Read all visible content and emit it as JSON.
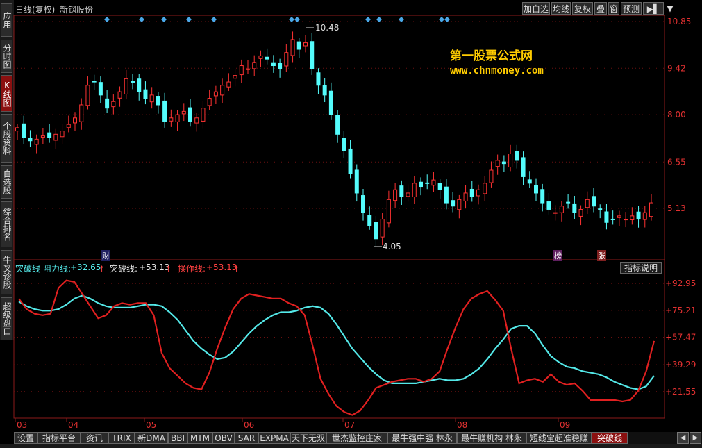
{
  "header": {
    "chart_mode": "日线(复权)",
    "stock_name": "新钢股份",
    "buttons": [
      "加自选",
      "均线",
      "复权",
      "叠",
      "窗",
      "预测"
    ],
    "menu_arrow": "▼"
  },
  "sidebar": {
    "items": [
      {
        "label": "应用",
        "active": false
      },
      {
        "label": "分时图",
        "active": false
      },
      {
        "label": "K线图",
        "active": true
      },
      {
        "label": "个股资料",
        "active": false
      },
      {
        "label": "自选股",
        "active": false
      },
      {
        "label": "综合排名",
        "active": false
      },
      {
        "label": "牛叉诊股",
        "active": false
      },
      {
        "label": "超级盘口",
        "active": false
      }
    ]
  },
  "watermark": {
    "line1": "第一股票公式网",
    "line2": "www.chnmoney.com"
  },
  "markers": {
    "cai": "财",
    "bang": "榜",
    "zhang": "张",
    "high_label": "10.48",
    "low_label": "4.05"
  },
  "indicator": {
    "name": "突破线",
    "resistance_label": "阻力线:",
    "resistance_value": "+32.65",
    "breakout_label": "突破线:",
    "breakout_value": "+53.13",
    "operation_label": "操作线:",
    "operation_value": "+53.13",
    "explain_button": "指标说明"
  },
  "tabs": [
    "设置",
    "指标平台",
    "资讯",
    "TRIX",
    "新DMA",
    "BBI",
    "MTM",
    "OBV",
    "SAR",
    "EXPMA",
    "天下无双",
    "世杰监控庄家",
    "最牛强中强 林永",
    "最牛赚机构 林永",
    "短线宝超准稳赚",
    "突破线"
  ],
  "active_tab": "突破线",
  "colors": {
    "up": "#ff3232",
    "down": "#54fcfc",
    "resistance": "#54e8e8",
    "breakout": "#e02020",
    "diamond": "#4aa8e8",
    "watermark": "#ffcc00"
  },
  "chart_data": [
    {
      "type": "candlestick",
      "ylim": [
        3.6,
        11.0
      ],
      "y_ticks": [
        "10.85",
        "9.42",
        "8.00",
        "6.55",
        "5.13"
      ],
      "x_ticks": [
        "03",
        "04",
        "05",
        "06",
        "07",
        "08",
        "09"
      ],
      "high_annotation": 10.48,
      "low_annotation": 4.05,
      "closes": [
        7.6,
        7.3,
        7.2,
        7.25,
        7.35,
        7.3,
        7.4,
        7.5,
        7.7,
        7.9,
        8.3,
        8.9,
        9.0,
        8.6,
        8.2,
        8.4,
        8.7,
        9.1,
        9.0,
        8.7,
        8.5,
        8.6,
        8.3,
        7.8,
        7.9,
        8.0,
        8.1,
        7.8,
        7.9,
        8.2,
        8.5,
        8.7,
        8.9,
        9.0,
        9.2,
        9.5,
        9.4,
        9.6,
        9.8,
        9.7,
        9.5,
        9.4,
        9.9,
        10.3,
        10.0,
        10.2,
        9.4,
        8.9,
        8.6,
        8.0,
        7.4,
        6.9,
        6.2,
        5.6,
        5.0,
        4.6,
        4.2,
        4.8,
        5.4,
        5.7,
        5.5,
        5.6,
        5.9,
        5.8,
        5.9,
        6.0,
        5.7,
        5.3,
        5.2,
        5.4,
        5.6,
        5.5,
        5.7,
        5.9,
        6.3,
        6.6,
        6.5,
        6.8,
        6.6,
        6.1,
        5.9,
        5.6,
        5.3,
        5.1,
        5.0,
        5.2,
        5.3,
        5.0,
        5.1,
        5.4,
        5.2,
        5.1,
        4.7,
        4.8,
        4.9,
        4.8,
        4.9,
        4.8,
        5.0,
        5.3
      ]
    },
    {
      "type": "line",
      "ylim": [
        4.0,
        99.0
      ],
      "y_ticks": [
        "+92.95",
        "+75.21",
        "+57.47",
        "+39.29",
        "+21.55"
      ],
      "series": [
        {
          "name": "阻力线",
          "values": [
            81,
            78,
            76,
            75,
            75,
            76,
            79,
            83,
            85,
            83,
            80,
            78,
            77,
            77,
            77,
            78,
            79,
            79,
            78,
            74,
            69,
            62,
            55,
            50,
            46,
            43,
            44,
            48,
            54,
            60,
            65,
            69,
            72,
            74,
            74,
            75,
            77,
            78,
            77,
            73,
            66,
            58,
            50,
            44,
            38,
            33,
            29,
            27,
            27,
            27,
            27,
            28,
            29,
            30,
            29,
            29,
            30,
            33,
            37,
            43,
            50,
            56,
            63,
            65,
            65,
            60,
            52,
            45,
            41,
            38,
            37,
            35,
            34,
            33,
            31,
            28,
            26,
            24,
            23,
            25,
            32
          ]
        },
        {
          "name": "突破线",
          "values": [
            83,
            76,
            73,
            72,
            73,
            90,
            95,
            94,
            86,
            78,
            70,
            72,
            78,
            80,
            79,
            80,
            80,
            72,
            47,
            37,
            32,
            27,
            24,
            23,
            34,
            50,
            64,
            76,
            83,
            86,
            85,
            84,
            83,
            83,
            80,
            78,
            72,
            52,
            30,
            20,
            12,
            8,
            6,
            9,
            16,
            24,
            26,
            28,
            29,
            30,
            30,
            28,
            30,
            35,
            50,
            64,
            76,
            83,
            86,
            88,
            82,
            75,
            50,
            27,
            29,
            30,
            28,
            33,
            28,
            26,
            27,
            22,
            16,
            16,
            16,
            16,
            15,
            16,
            22,
            35,
            55
          ]
        }
      ]
    }
  ]
}
